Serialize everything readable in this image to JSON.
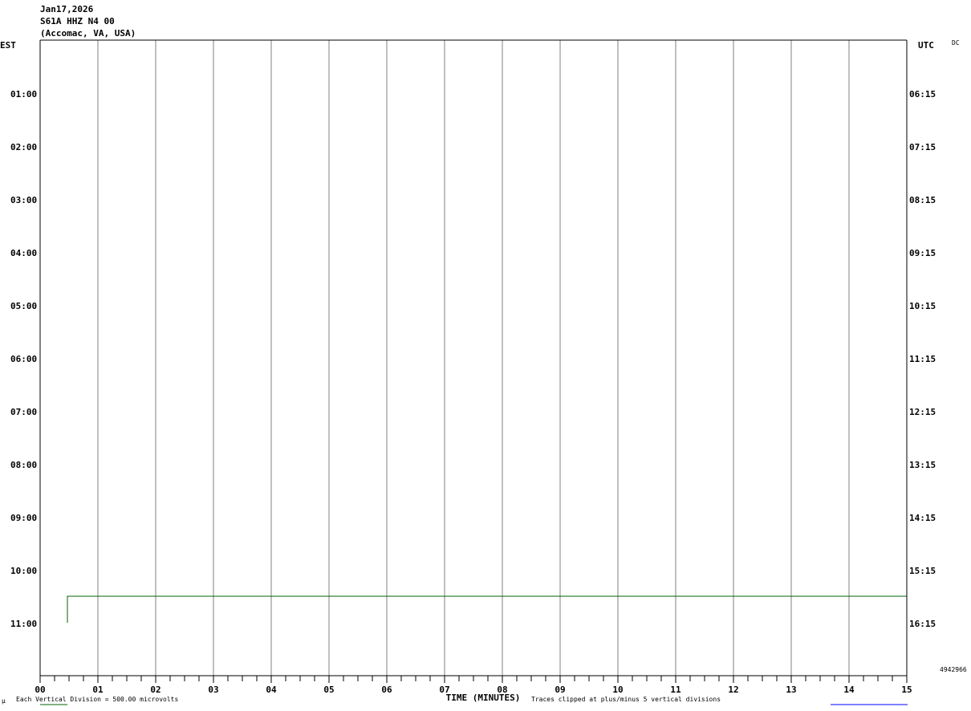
{
  "header": {
    "date": "Jan17,2026",
    "station": "S61A HHZ N4 00",
    "location": "(Accomac, VA, USA)"
  },
  "left_zone_label": "EST",
  "right_zone_label": "UTC",
  "corner_label": "DC",
  "side_number": "4942966",
  "footer": {
    "scale_note": "Each Vertical Division =  500.00 microvolts",
    "clip_note": "Traces clipped at plus/minus 5 vertical divisions",
    "corner_mark": "μ"
  },
  "colors": {
    "grid": "#808080",
    "axis": "#000000",
    "trace": "#006400",
    "link": "#0000ff"
  },
  "chart_data": {
    "type": "line",
    "xlabel": "TIME (MINUTES)",
    "xlim": [
      0,
      15
    ],
    "x_tick_labels": [
      "00",
      "01",
      "02",
      "03",
      "04",
      "05",
      "06",
      "07",
      "08",
      "09",
      "10",
      "11",
      "12",
      "13",
      "14",
      "15"
    ],
    "minor_ticks_per_minute": 4,
    "rows": 12,
    "left_row_labels": [
      "",
      "01:00",
      "02:00",
      "03:00",
      "04:00",
      "05:00",
      "06:00",
      "07:00",
      "08:00",
      "09:00",
      "10:00",
      "11:00"
    ],
    "right_row_labels": [
      "",
      "06:15",
      "07:15",
      "08:15",
      "09:15",
      "10:15",
      "11:15",
      "12:15",
      "13:15",
      "14:15",
      "15:15",
      "16:15"
    ],
    "grid": true,
    "series": [
      {
        "row": 10.5,
        "x": [
          0.47,
          0.47,
          15
        ],
        "y_divisions": [
          -5,
          0,
          0
        ]
      }
    ]
  }
}
